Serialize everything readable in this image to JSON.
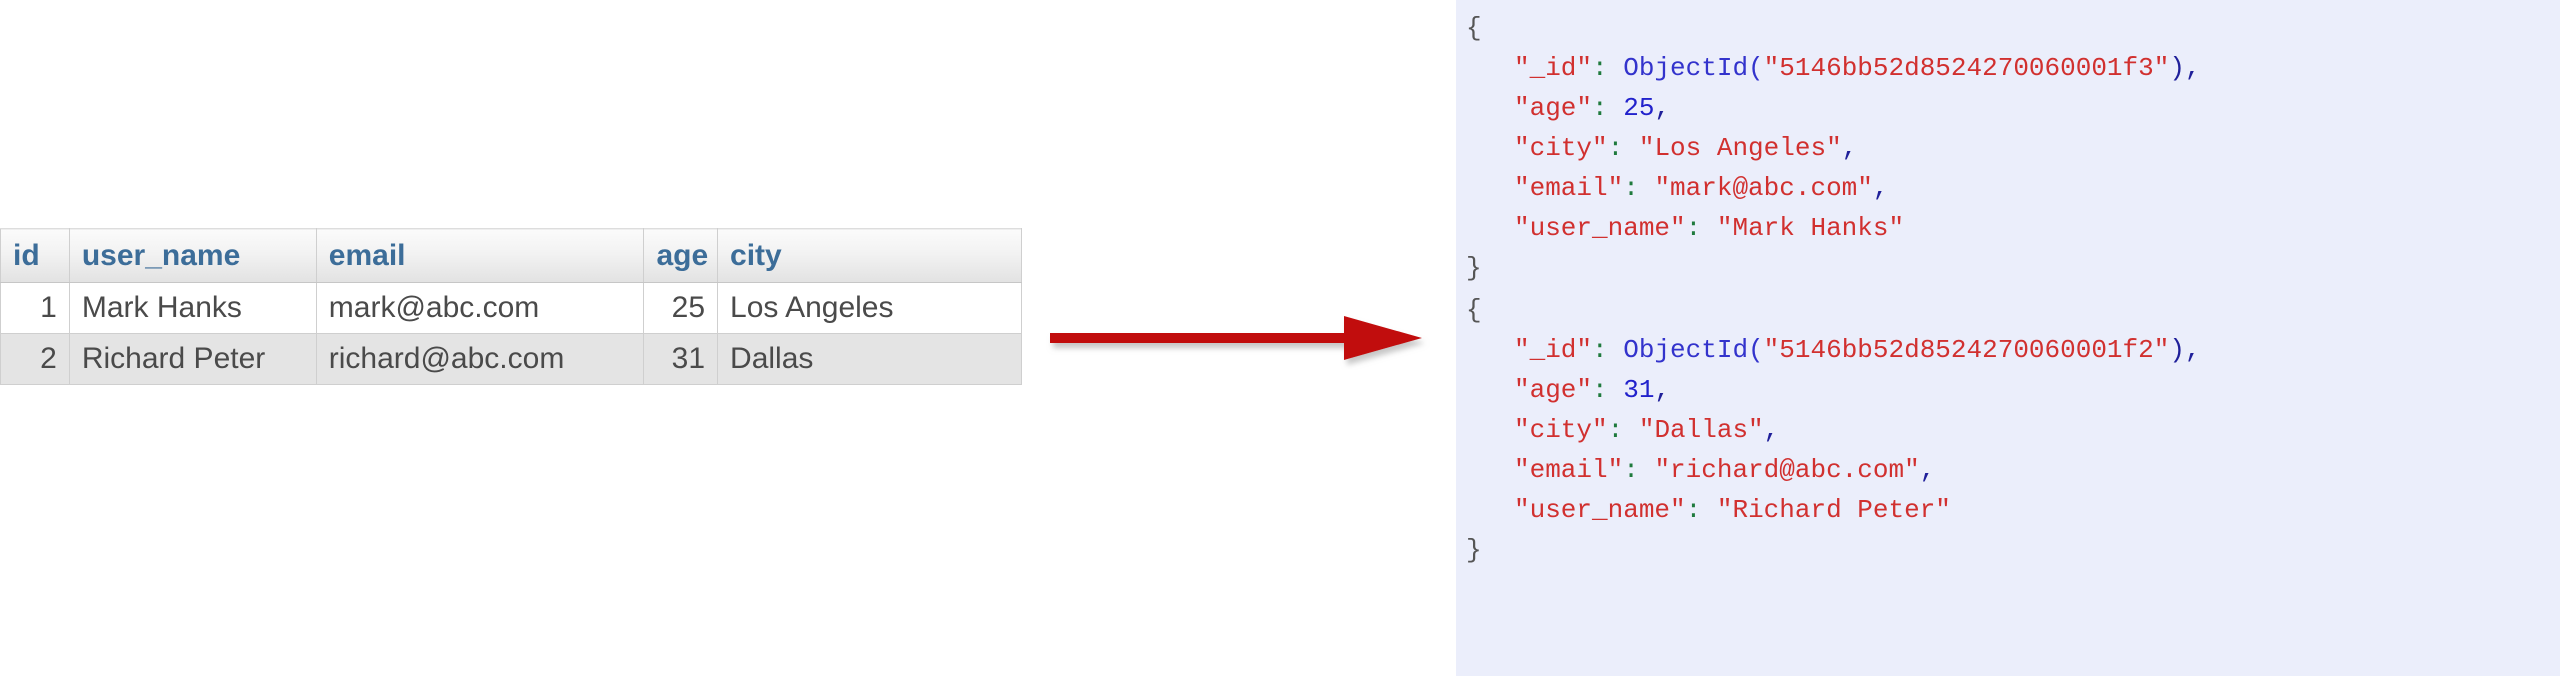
{
  "table": {
    "columns": [
      "id",
      "user_name",
      "email",
      "age",
      "city"
    ],
    "rows": [
      {
        "id": "1",
        "user_name": "Mark Hanks",
        "email": "mark@abc.com",
        "age": "25",
        "city": "Los Angeles"
      },
      {
        "id": "2",
        "user_name": "Richard Peter",
        "email": "richard@abc.com",
        "age": "31",
        "city": "Dallas"
      }
    ]
  },
  "arrow": {
    "name": "right-arrow",
    "color": "#c10d0d",
    "direction": "right"
  },
  "json_pane": {
    "background": "#ebeefb",
    "documents": [
      {
        "open_brace": "{",
        "close_brace": "}",
        "fields": [
          {
            "key": "\"_id\"",
            "colon": ":",
            "fn": "ObjectId(",
            "quote_open": "\"",
            "hex": "5146bb52d8524270060001f3",
            "quote_close": "\"",
            "fn_close": ")",
            "comma": ","
          },
          {
            "key": "\"age\"",
            "colon": ":",
            "number": "25",
            "comma": ","
          },
          {
            "key": "\"city\"",
            "colon": ":",
            "string": "\"Los Angeles\"",
            "comma": ","
          },
          {
            "key": "\"email\"",
            "colon": ":",
            "string": "\"mark@abc.com\"",
            "comma": ","
          },
          {
            "key": "\"user_name\"",
            "colon": ":",
            "string": "\"Mark Hanks\"",
            "comma": ""
          }
        ]
      },
      {
        "open_brace": "{",
        "close_brace": "}",
        "fields": [
          {
            "key": "\"_id\"",
            "colon": ":",
            "fn": "ObjectId(",
            "quote_open": "\"",
            "hex": "5146bb52d8524270060001f2",
            "quote_close": "\"",
            "fn_close": ")",
            "comma": ","
          },
          {
            "key": "\"age\"",
            "colon": ":",
            "number": "31",
            "comma": ","
          },
          {
            "key": "\"city\"",
            "colon": ":",
            "string": "\"Dallas\"",
            "comma": ","
          },
          {
            "key": "\"email\"",
            "colon": ":",
            "string": "\"richard@abc.com\"",
            "comma": ","
          },
          {
            "key": "\"user_name\"",
            "colon": ":",
            "string": "\"Richard Peter\"",
            "comma": ""
          }
        ]
      }
    ]
  }
}
